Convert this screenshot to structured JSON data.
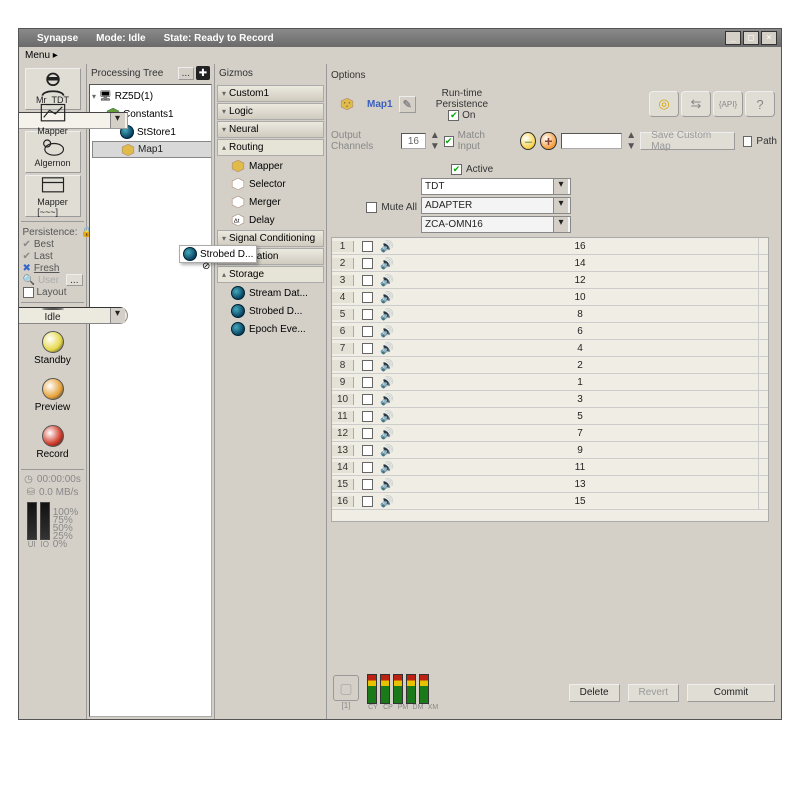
{
  "titlebar": {
    "app": "Synapse",
    "mode": "Mode: Idle",
    "state": "State: Ready to Record"
  },
  "menubar": {
    "menu": "Menu ▸"
  },
  "rail": {
    "items": [
      {
        "label": "Mr_TDT"
      },
      {
        "label": "Mapper"
      },
      {
        "label": "Algernon"
      },
      {
        "label": "Mapper\n[~~~]"
      }
    ],
    "persistence": {
      "title": "Persistence:",
      "best": "Best",
      "last": "Last",
      "fresh": "Fresh",
      "user": "User",
      "more": "...",
      "layout": "Layout"
    },
    "states": {
      "idle": "Idle",
      "standby": "Standby",
      "preview": "Preview",
      "record": "Record"
    },
    "timer": "00:00:00s",
    "rate": "0.0 MB/s",
    "meters": {
      "ui": "UI",
      "io": "IO"
    },
    "ticks": {
      "t100": "100%",
      "t75": "75%",
      "t50": "50%",
      "t25": "25%",
      "t0": "0%"
    }
  },
  "ptree": {
    "title": "Processing Tree",
    "root": "RZ5D(1)",
    "n1": "Constants1",
    "n2": "StStore1",
    "n3": "Map1",
    "drag": "Strobed D..."
  },
  "gizmos": {
    "title": "Gizmos",
    "cats": {
      "custom": "Custom1",
      "logic": "Logic",
      "neural": "Neural",
      "routing": "Routing",
      "sigcond": "Signal Conditioning",
      "stim": "Stimulation",
      "storage": "Storage"
    },
    "routing": {
      "mapper": "Mapper",
      "selector": "Selector",
      "merger": "Merger",
      "delay": "Delay"
    },
    "storage": {
      "stream": "Stream Dat...",
      "strobed": "Strobed D...",
      "epoch": "Epoch Eve..."
    }
  },
  "options": {
    "title_panel": "Options",
    "name": "Map1",
    "runtime_l1": "Run-time",
    "runtime_l2": "Persistence",
    "runtime_on": "On",
    "out_ch_label": "Output Channels",
    "out_ch_val": "16",
    "match": "Match Input",
    "save_map": "Save Custom Map",
    "path": "Path",
    "active": "Active",
    "mute": "Mute All",
    "dd1": "TDT",
    "dd2": "ADAPTER",
    "dd3": "ZCA-OMN16",
    "channels": [
      {
        "i": 1,
        "v": 16
      },
      {
        "i": 2,
        "v": 14
      },
      {
        "i": 3,
        "v": 12
      },
      {
        "i": 4,
        "v": 10
      },
      {
        "i": 5,
        "v": 8
      },
      {
        "i": 6,
        "v": 6
      },
      {
        "i": 7,
        "v": 4
      },
      {
        "i": 8,
        "v": 2
      },
      {
        "i": 9,
        "v": 1
      },
      {
        "i": 10,
        "v": 3
      },
      {
        "i": 11,
        "v": 5
      },
      {
        "i": 12,
        "v": 7
      },
      {
        "i": 13,
        "v": 9
      },
      {
        "i": 14,
        "v": 11
      },
      {
        "i": 15,
        "v": 13
      },
      {
        "i": 16,
        "v": 15
      }
    ],
    "foot": {
      "idx": "[1]",
      "bars": [
        "CY",
        "CP",
        "PM",
        "DM",
        "XM"
      ],
      "delete": "Delete",
      "revert": "Revert",
      "commit": "Commit"
    }
  }
}
